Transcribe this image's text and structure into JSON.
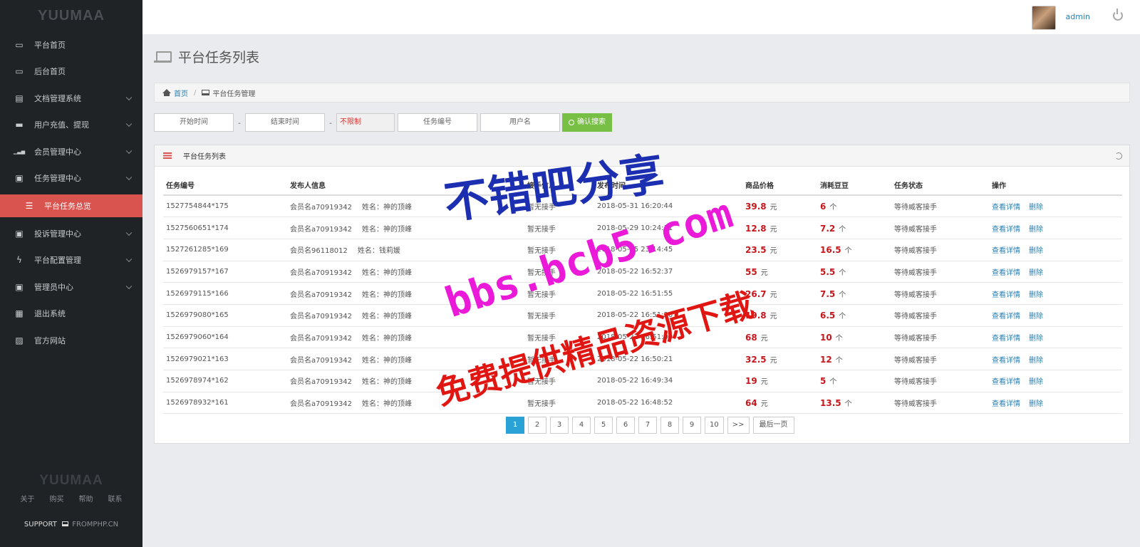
{
  "sidebar": {
    "logo": "YUUMAA",
    "items": [
      {
        "label": "平台首页",
        "icon": "laptop-icon",
        "chevron": false
      },
      {
        "label": "后台首页",
        "icon": "laptop-icon",
        "chevron": false
      },
      {
        "label": "文档管理系统",
        "icon": "file-icon",
        "chevron": true
      },
      {
        "label": "用户充值、提现",
        "icon": "card-icon",
        "chevron": true
      },
      {
        "label": "会员管理中心",
        "icon": "signal-icon",
        "chevron": true
      },
      {
        "label": "任务管理中心",
        "icon": "briefcase-icon",
        "chevron": true
      },
      {
        "label": "平台任务总览",
        "icon": "list-icon",
        "active": true
      },
      {
        "label": "投诉管理中心",
        "icon": "briefcase-icon",
        "chevron": true
      },
      {
        "label": "平台配置管理",
        "icon": "bolt-icon",
        "chevron": true
      },
      {
        "label": "管理员中心",
        "icon": "briefcase-icon",
        "chevron": true
      },
      {
        "label": "退出系统",
        "icon": "calendar-icon",
        "chevron": false
      },
      {
        "label": "官方网站",
        "icon": "image-icon",
        "chevron": false
      }
    ],
    "footer_logo": "YUUMAA",
    "footer_links": [
      "关于",
      "购买",
      "帮助",
      "联系"
    ],
    "support_label": "SUPPORT",
    "support_brand": "FROMPHP.CN"
  },
  "topbar": {
    "username": "admin"
  },
  "page": {
    "title": "平台任务列表",
    "breadcrumb_home": "首页",
    "breadcrumb_current": "平台任务管理"
  },
  "filters": {
    "start_placeholder": "开始时间",
    "end_placeholder": "结束时间",
    "dash": "-",
    "select_value": "不限制",
    "task_no_placeholder": "任务编号",
    "username_placeholder": "用户名",
    "search_label": "确认搜索"
  },
  "panel": {
    "title": "平台任务列表",
    "columns": [
      "任务编号",
      "发布人信息",
      "接手信息",
      "发布时间",
      "商品价格",
      "消耗豆豆",
      "任务状态",
      "操作"
    ],
    "price_unit": "元",
    "bean_unit": "个",
    "action_view": "查看详情",
    "action_delete": "删除",
    "rows": [
      {
        "id": "1527754844*175",
        "pub_member": "会员名a70919342",
        "pub_name": "姓名：神的顶峰",
        "taker": "暂无接手",
        "time": "2018-05-31 16:20:44",
        "price": "39.8",
        "beans": "6",
        "status": "等待威客接手"
      },
      {
        "id": "1527560651*174",
        "pub_member": "会员名a70919342",
        "pub_name": "姓名：神的顶峰",
        "taker": "暂无接手",
        "time": "2018-05-29 10:24:11",
        "price": "12.8",
        "beans": "7.2",
        "status": "等待威客接手"
      },
      {
        "id": "1527261285*169",
        "pub_member": "会员名96118012",
        "pub_name": "姓名：钱莉媛",
        "taker": "暂无接手",
        "time": "2018-05-25 23:14:45",
        "price": "23.5",
        "beans": "16.5",
        "status": "等待威客接手"
      },
      {
        "id": "1526979157*167",
        "pub_member": "会员名a70919342",
        "pub_name": "姓名：神的顶峰",
        "taker": "暂无接手",
        "time": "2018-05-22 16:52:37",
        "price": "55",
        "beans": "5.5",
        "status": "等待威客接手"
      },
      {
        "id": "1526979115*166",
        "pub_member": "会员名a70919342",
        "pub_name": "姓名：神的顶峰",
        "taker": "暂无接手",
        "time": "2018-05-22 16:51:55",
        "price": "26.7",
        "beans": "7.5",
        "status": "等待威客接手"
      },
      {
        "id": "1526979080*165",
        "pub_member": "会员名a70919342",
        "pub_name": "姓名：神的顶峰",
        "taker": "暂无接手",
        "time": "2018-05-22 16:51:20",
        "price": "19.8",
        "beans": "6.5",
        "status": "等待威客接手"
      },
      {
        "id": "1526979060*164",
        "pub_member": "会员名a70919342",
        "pub_name": "姓名：神的顶峰",
        "taker": "暂无接手",
        "time": "2018-05-22 16:51:00",
        "price": "68",
        "beans": "10",
        "status": "等待威客接手"
      },
      {
        "id": "1526979021*163",
        "pub_member": "会员名a70919342",
        "pub_name": "姓名：神的顶峰",
        "taker": "暂无接手",
        "time": "2018-05-22 16:50:21",
        "price": "32.5",
        "beans": "12",
        "status": "等待威客接手"
      },
      {
        "id": "1526978974*162",
        "pub_member": "会员名a70919342",
        "pub_name": "姓名：神的顶峰",
        "taker": "暂无接手",
        "time": "2018-05-22 16:49:34",
        "price": "19",
        "beans": "5",
        "status": "等待威客接手"
      },
      {
        "id": "1526978932*161",
        "pub_member": "会员名a70919342",
        "pub_name": "姓名：神的顶峰",
        "taker": "暂无接手",
        "time": "2018-05-22 16:48:52",
        "price": "64",
        "beans": "13.5",
        "status": "等待威客接手"
      }
    ],
    "pages": [
      "1",
      "2",
      "3",
      "4",
      "5",
      "6",
      "7",
      "8",
      "9",
      "10",
      ">>",
      "最后一页"
    ],
    "current_page": "1"
  },
  "watermark": {
    "line1": "不错吧分享",
    "line2": "bbs.bcb5.com",
    "line3": "免费提供精品资源下载"
  },
  "colors": {
    "sidebar_bg": "#1f2326",
    "active_item": "#d9534f",
    "search_button": "#78c045",
    "price_red": "#c7161c",
    "link_blue": "#2a7fb0",
    "pager_active": "#2aa2d6"
  }
}
